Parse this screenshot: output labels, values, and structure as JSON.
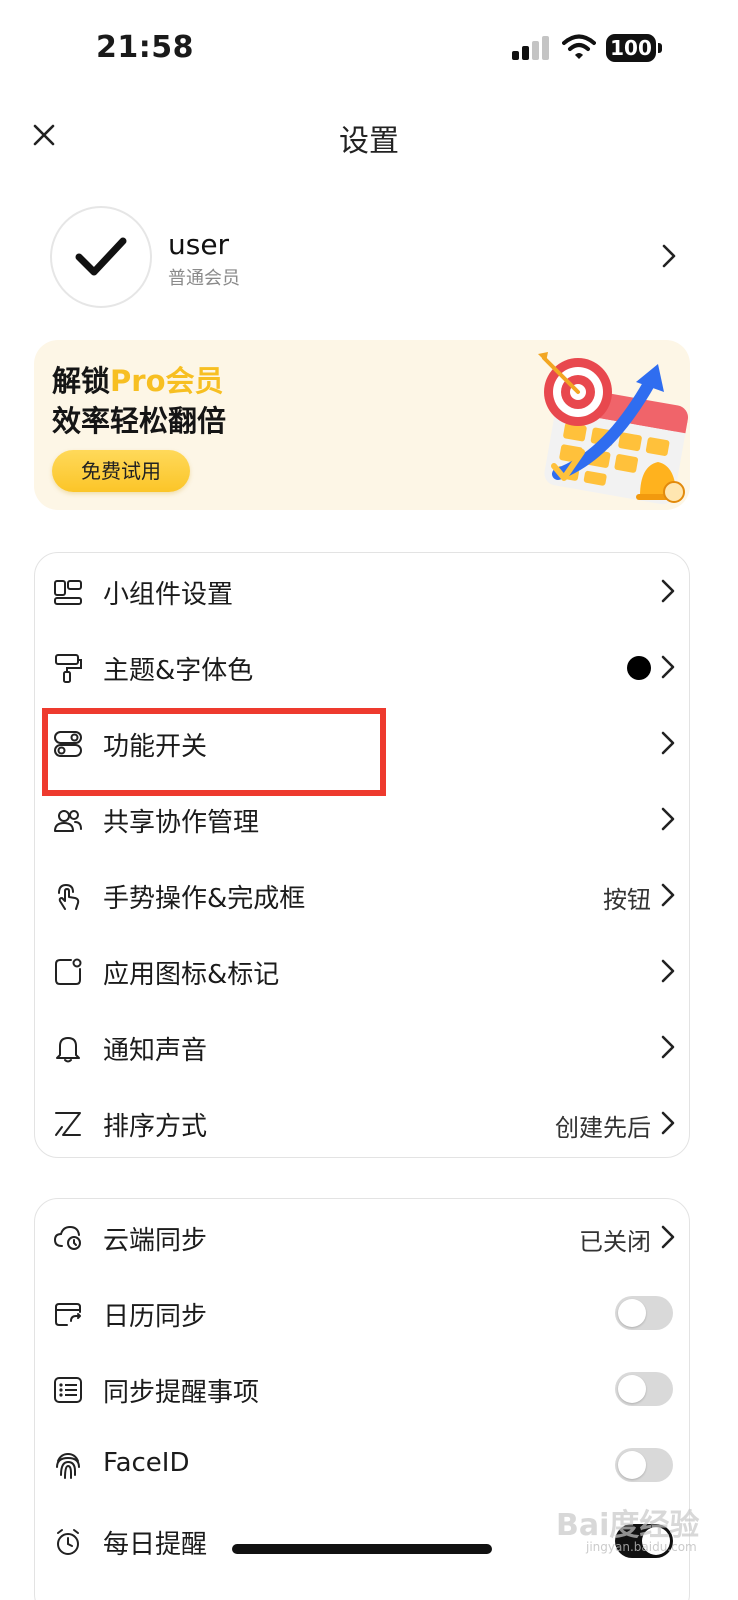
{
  "status_bar": {
    "time": "21:58",
    "battery": "100"
  },
  "nav": {
    "title": "设置"
  },
  "profile": {
    "username": "user",
    "level": "普通会员"
  },
  "pro_banner": {
    "line1_prefix": "解锁",
    "line1_accent": "Pro会员",
    "line2": "效率轻松翻倍",
    "button": "免费试用",
    "accent_color": "#f7bf22"
  },
  "settings_group_1": {
    "items": [
      {
        "label": "小组件设置",
        "icon": "widget-icon"
      },
      {
        "label": "主题&字体色",
        "icon": "paint-roller-icon",
        "value_color": "#000000"
      },
      {
        "label": "功能开关",
        "icon": "toggle-switch-icon"
      },
      {
        "label": "共享协作管理",
        "icon": "users-icon"
      },
      {
        "label": "手势操作&完成框",
        "icon": "hand-gesture-icon",
        "value": "按钮"
      },
      {
        "label": "应用图标&标记",
        "icon": "app-badge-icon"
      },
      {
        "label": "通知声音",
        "icon": "bell-icon"
      },
      {
        "label": "排序方式",
        "icon": "sort-icon",
        "value": "创建先后"
      }
    ]
  },
  "settings_group_2": {
    "items": [
      {
        "label": "云端同步",
        "icon": "cloud-sync-icon",
        "value": "已关闭"
      },
      {
        "label": "日历同步",
        "icon": "calendar-sync-icon",
        "toggle": false
      },
      {
        "label": "同步提醒事项",
        "icon": "reminder-list-icon",
        "toggle": false
      },
      {
        "label": "FaceID",
        "icon": "fingerprint-icon",
        "toggle": false
      },
      {
        "label": "每日提醒",
        "icon": "alarm-icon",
        "toggle": true
      }
    ]
  },
  "highlight": {
    "target": "功能开关",
    "color": "#ee3a2e"
  },
  "watermark": {
    "text": "Bai度经验",
    "url": "jingyan.baidu.com"
  }
}
